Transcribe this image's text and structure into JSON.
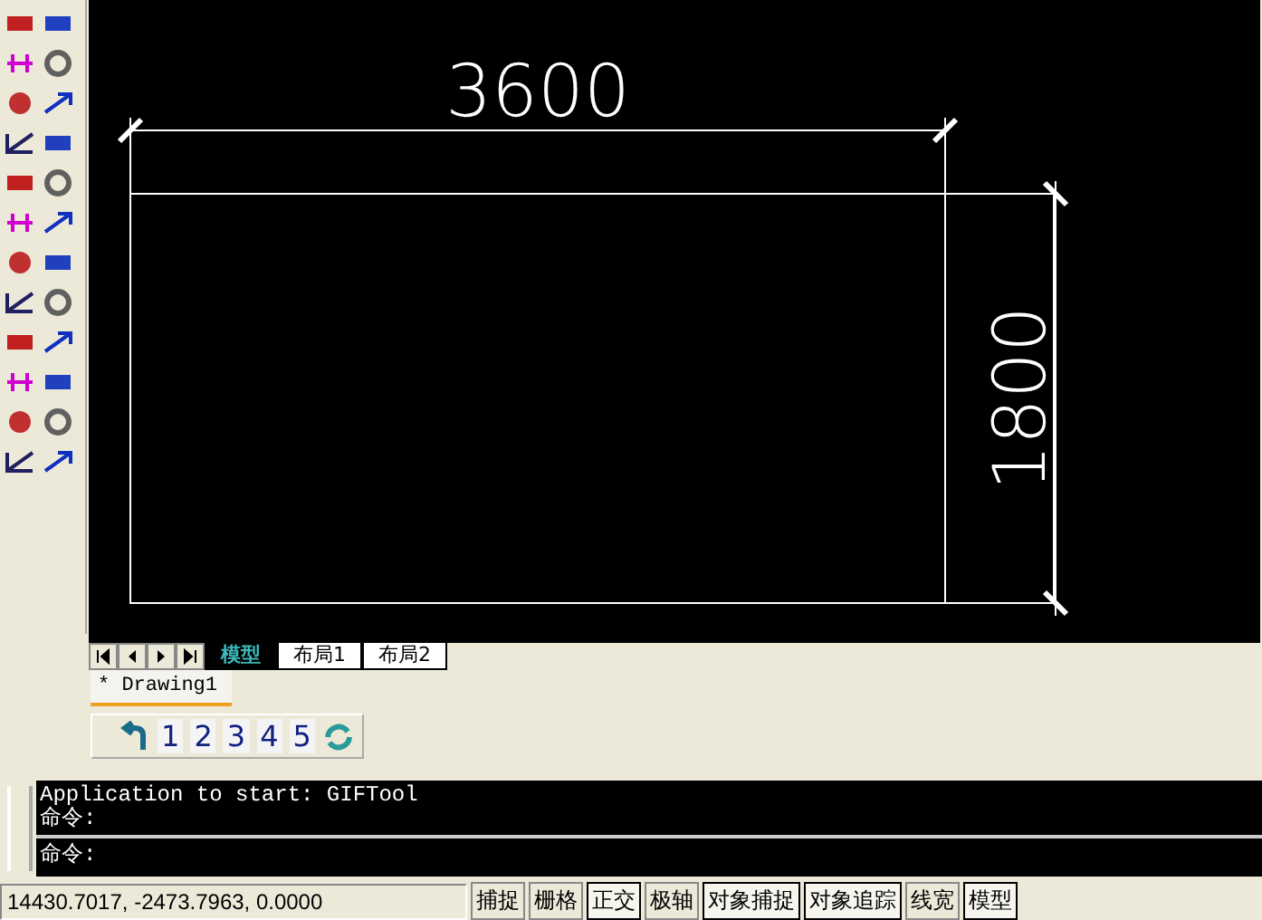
{
  "drawing": {
    "horizontal_dimension": "3600",
    "vertical_dimension": "1800"
  },
  "layout_tabs": [
    {
      "label": "模型",
      "selected": true
    },
    {
      "label": "布局1",
      "selected": false
    },
    {
      "label": "布局2",
      "selected": false
    }
  ],
  "document_tab": {
    "label": "* Drawing1",
    "selected": true
  },
  "view_toolbar": {
    "buttons": [
      "1",
      "2",
      "3",
      "4",
      "5"
    ]
  },
  "command_history": [
    "Application to start: GIFTool",
    "命令:"
  ],
  "command_prompt": "命令:",
  "status_bar": {
    "coordinates": "14430.7017, -2473.7963, 0.0000",
    "toggles": [
      {
        "label": "捕捉",
        "on": false
      },
      {
        "label": "栅格",
        "on": false
      },
      {
        "label": "正交",
        "on": true
      },
      {
        "label": "极轴",
        "on": false
      },
      {
        "label": "对象捕捉",
        "on": true
      },
      {
        "label": "对象追踪",
        "on": true
      },
      {
        "label": "线宽",
        "on": false
      },
      {
        "label": "模型",
        "on": true
      }
    ]
  }
}
